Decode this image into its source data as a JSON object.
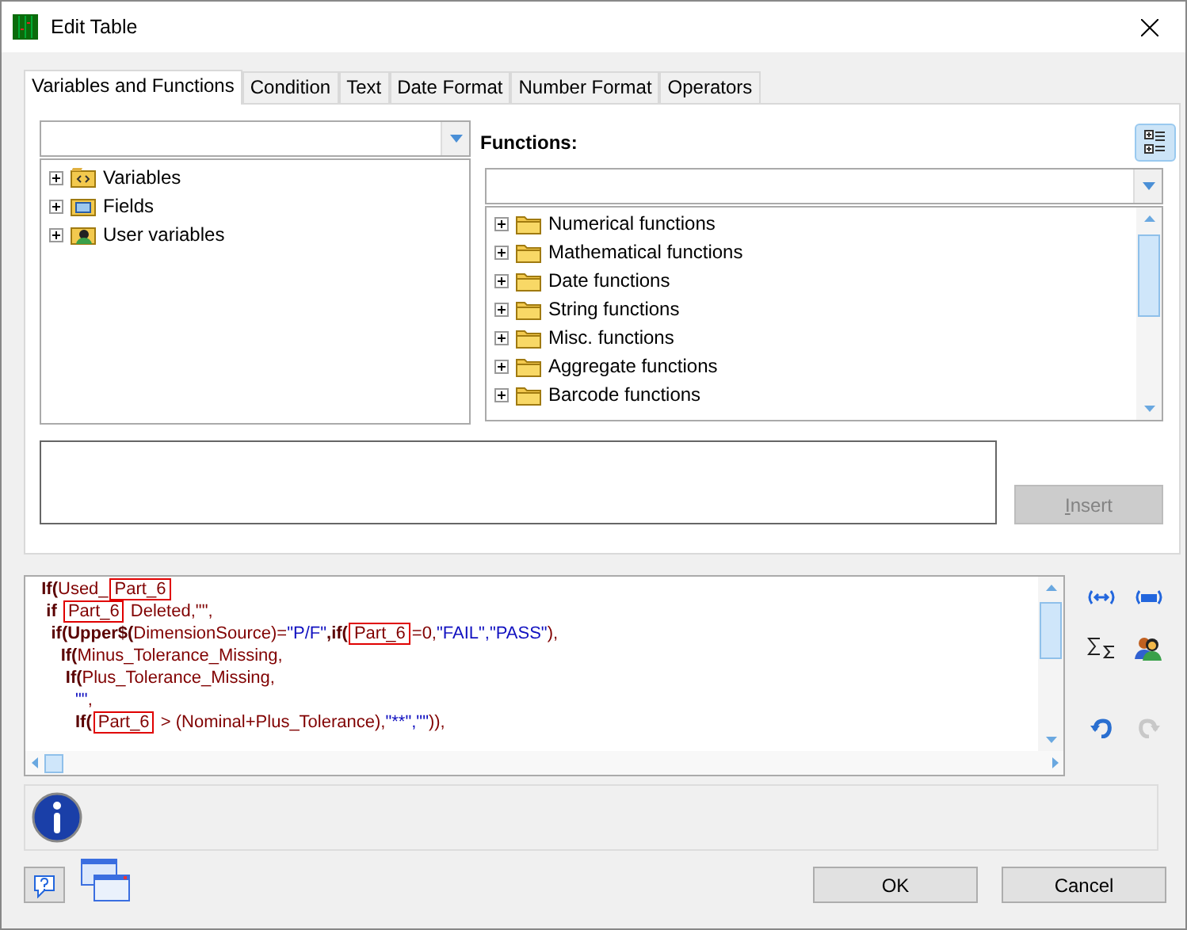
{
  "window": {
    "title": "Edit Table"
  },
  "tabs": [
    {
      "label": "Variables and Functions",
      "selected": true
    },
    {
      "label": "Condition",
      "selected": false
    },
    {
      "label": "Text",
      "selected": false
    },
    {
      "label": "Date Format",
      "selected": false
    },
    {
      "label": "Number Format",
      "selected": false
    },
    {
      "label": "Operators",
      "selected": false
    }
  ],
  "variables_tree": [
    {
      "label": "Variables",
      "kind": "variables",
      "expanded": false
    },
    {
      "label": "Fields",
      "kind": "fields",
      "expanded": false
    },
    {
      "label": "User variables",
      "kind": "user",
      "expanded": false
    }
  ],
  "functions_label": "Functions:",
  "functions_tree": [
    {
      "label": "Numerical functions",
      "expanded": false
    },
    {
      "label": "Mathematical functions",
      "expanded": false
    },
    {
      "label": "Date functions",
      "expanded": false
    },
    {
      "label": "String functions",
      "expanded": false
    },
    {
      "label": "Misc. functions",
      "expanded": false
    },
    {
      "label": "Aggregate functions",
      "expanded": false
    },
    {
      "label": "Barcode functions",
      "expanded": false
    }
  ],
  "insert_button": {
    "label": "Insert",
    "disabled": true
  },
  "code_lines": [
    [
      {
        "text": "  If(",
        "kind": "func"
      },
      {
        "text": "Used_",
        "kind": "ident"
      },
      {
        "text": "Part_6",
        "kind": "ident",
        "boxed": true
      }
    ],
    [
      {
        "text": "   if ",
        "kind": "func"
      },
      {
        "text": "Part_6",
        "kind": "ident",
        "boxed": true
      },
      {
        "text": " Deleted",
        "kind": "ident"
      },
      {
        "text": ",\"\",",
        "kind": "op"
      }
    ],
    [
      {
        "text": "    if(Upper$(",
        "kind": "func"
      },
      {
        "text": "DimensionSource",
        "kind": "ident"
      },
      {
        "text": ")=",
        "kind": "op"
      },
      {
        "text": "\"P/F\"",
        "kind": "str"
      },
      {
        "text": ",if(",
        "kind": "func"
      },
      {
        "text": "Part_6",
        "kind": "ident",
        "boxed": true
      },
      {
        "text": "=0,",
        "kind": "op"
      },
      {
        "text": "\"FAIL\",\"PASS\"",
        "kind": "str"
      },
      {
        "text": "),",
        "kind": "op"
      }
    ],
    [
      {
        "text": "      If(",
        "kind": "func"
      },
      {
        "text": "Minus_Tolerance_Missing",
        "kind": "ident"
      },
      {
        "text": ",",
        "kind": "op"
      }
    ],
    [
      {
        "text": "       If(",
        "kind": "func"
      },
      {
        "text": "Plus_Tolerance_Missing",
        "kind": "ident"
      },
      {
        "text": ",",
        "kind": "op"
      }
    ],
    [
      {
        "text": "         \"\"",
        "kind": "str"
      },
      {
        "text": ",",
        "kind": "op"
      }
    ],
    [
      {
        "text": "         If(",
        "kind": "func"
      },
      {
        "text": "Part_6",
        "kind": "ident",
        "boxed": true
      },
      {
        "text": " > ",
        "kind": "op"
      },
      {
        "text": "(Nominal+Plus_Tolerance)",
        "kind": "ident"
      },
      {
        "text": ",",
        "kind": "op"
      },
      {
        "text": "\"**\",\"\"",
        "kind": "str"
      },
      {
        "text": ")),",
        "kind": "op"
      }
    ]
  ],
  "buttons": [
    {
      "label": "OK"
    },
    {
      "label": "Cancel"
    }
  ]
}
